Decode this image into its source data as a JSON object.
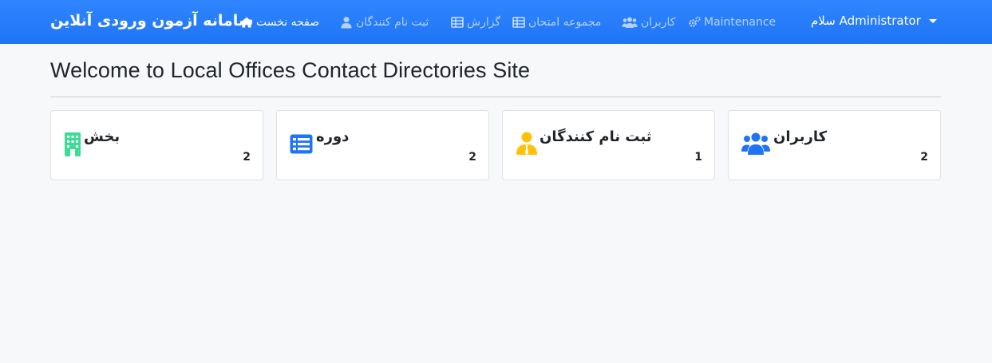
{
  "navbar": {
    "brand": "سامانه آزمون ورودی آنلاین",
    "items": [
      {
        "label": "صفحه نخست",
        "icon": "home-icon"
      },
      {
        "label": "ثبت نام کنندگان",
        "icon": "user-icon"
      },
      {
        "label": "گزارش",
        "icon": "table-icon"
      },
      {
        "label": "مجموعه امتحان",
        "icon": "table-icon"
      },
      {
        "label": "کاربران",
        "icon": "users-icon"
      },
      {
        "label": "Maintenance",
        "icon": "gears-icon"
      }
    ],
    "user_menu": "سلام Administrator"
  },
  "main": {
    "title": "Welcome to Local Offices Contact Directories Site"
  },
  "cards": [
    {
      "label": "بخش",
      "count": "2",
      "icon": "building-icon",
      "color": "#3ddc97"
    },
    {
      "label": "دوره",
      "count": "2",
      "icon": "list-icon",
      "color": "#1f74f5"
    },
    {
      "label": "ثبت نام کنندگان",
      "count": "1",
      "icon": "user-tie-icon",
      "color": "#ffc107"
    },
    {
      "label": "کاربران",
      "count": "2",
      "icon": "users-icon",
      "color": "#1f74f5"
    }
  ],
  "colors": {
    "navbar": "#1f74f5",
    "background": "#f7f8fa"
  }
}
